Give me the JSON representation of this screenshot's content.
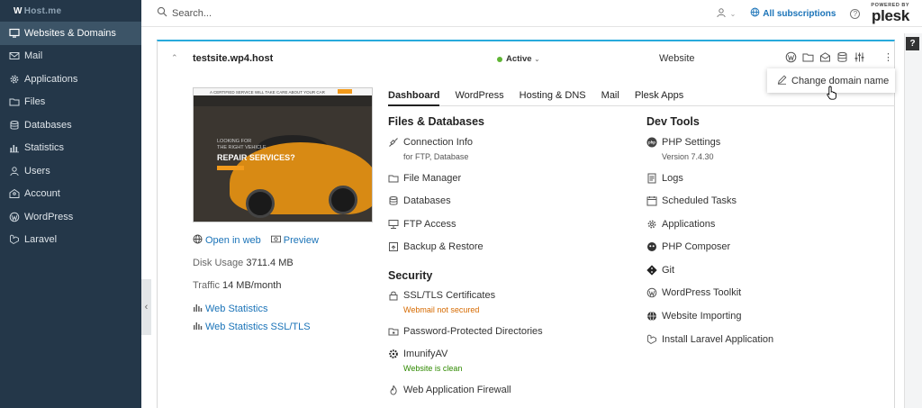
{
  "sidebar": {
    "logo_mark": "W",
    "logo_text": "Host.me",
    "items": [
      {
        "label": "Websites & Domains",
        "icon": "monitor-icon",
        "active": true
      },
      {
        "label": "Mail",
        "icon": "mail-icon"
      },
      {
        "label": "Applications",
        "icon": "gear-icon"
      },
      {
        "label": "Files",
        "icon": "folder-icon"
      },
      {
        "label": "Databases",
        "icon": "database-icon"
      },
      {
        "label": "Statistics",
        "icon": "bar-chart-icon"
      },
      {
        "label": "Users",
        "icon": "user-icon"
      },
      {
        "label": "Account",
        "icon": "account-icon"
      },
      {
        "label": "WordPress",
        "icon": "wordpress-icon"
      },
      {
        "label": "Laravel",
        "icon": "laravel-icon"
      }
    ],
    "collapse_glyph": "‹"
  },
  "header": {
    "search_placeholder": "Search...",
    "user_chevron": "⌄",
    "subscriptions": "All subscriptions",
    "help": "?",
    "powered_by": "POWERED BY",
    "brand": "plesk"
  },
  "side_help": "?",
  "domain": {
    "name": "testsite.wp4.host",
    "status": "Active",
    "type": "Website",
    "more": "⋮",
    "menu_item": "Change domain name"
  },
  "preview": {
    "top_text": "A CERTIFIED SERVICE WILL TAKE CARE ABOUT YOUR CAR",
    "line1": "LOOKING FOR",
    "line2": "THE RIGHT VEHICLE",
    "headline": "REPAIR SERVICES?"
  },
  "info": {
    "open_in_web": "Open in web",
    "preview": "Preview",
    "disk_label": "Disk Usage",
    "disk_value": "3711.4 MB",
    "traffic_label": "Traffic",
    "traffic_value": "14 MB/month",
    "web_stats": "Web Statistics",
    "web_stats_ssl": "Web Statistics SSL/TLS"
  },
  "tabs": [
    "Dashboard",
    "WordPress",
    "Hosting & DNS",
    "Mail",
    "Plesk Apps"
  ],
  "files_databases": {
    "title": "Files & Databases",
    "connection_info": "Connection Info",
    "connection_info_sub": "for FTP, Database",
    "file_manager": "File Manager",
    "databases": "Databases",
    "ftp_access": "FTP Access",
    "backup_restore": "Backup & Restore"
  },
  "security": {
    "title": "Security",
    "ssl": "SSL/TLS Certificates",
    "ssl_sub": "Webmail not secured",
    "password_dirs": "Password-Protected Directories",
    "imunify": "ImunifyAV",
    "imunify_sub": "Website is clean",
    "waf": "Web Application Firewall"
  },
  "dev_tools": {
    "title": "Dev Tools",
    "php_settings": "PHP Settings",
    "php_version": "Version 7.4.30",
    "logs": "Logs",
    "scheduled_tasks": "Scheduled Tasks",
    "applications": "Applications",
    "php_composer": "PHP Composer",
    "git": "Git",
    "wp_toolkit": "WordPress Toolkit",
    "website_importing": "Website Importing",
    "install_laravel": "Install Laravel Application"
  },
  "colors": {
    "sidebar_bg": "#243749",
    "sidebar_active": "#3c5467",
    "link": "#1a73b8",
    "accent_border": "#28aadc",
    "status_green": "#5fb534",
    "warning": "#d66a00",
    "ok": "#2f8a00"
  }
}
